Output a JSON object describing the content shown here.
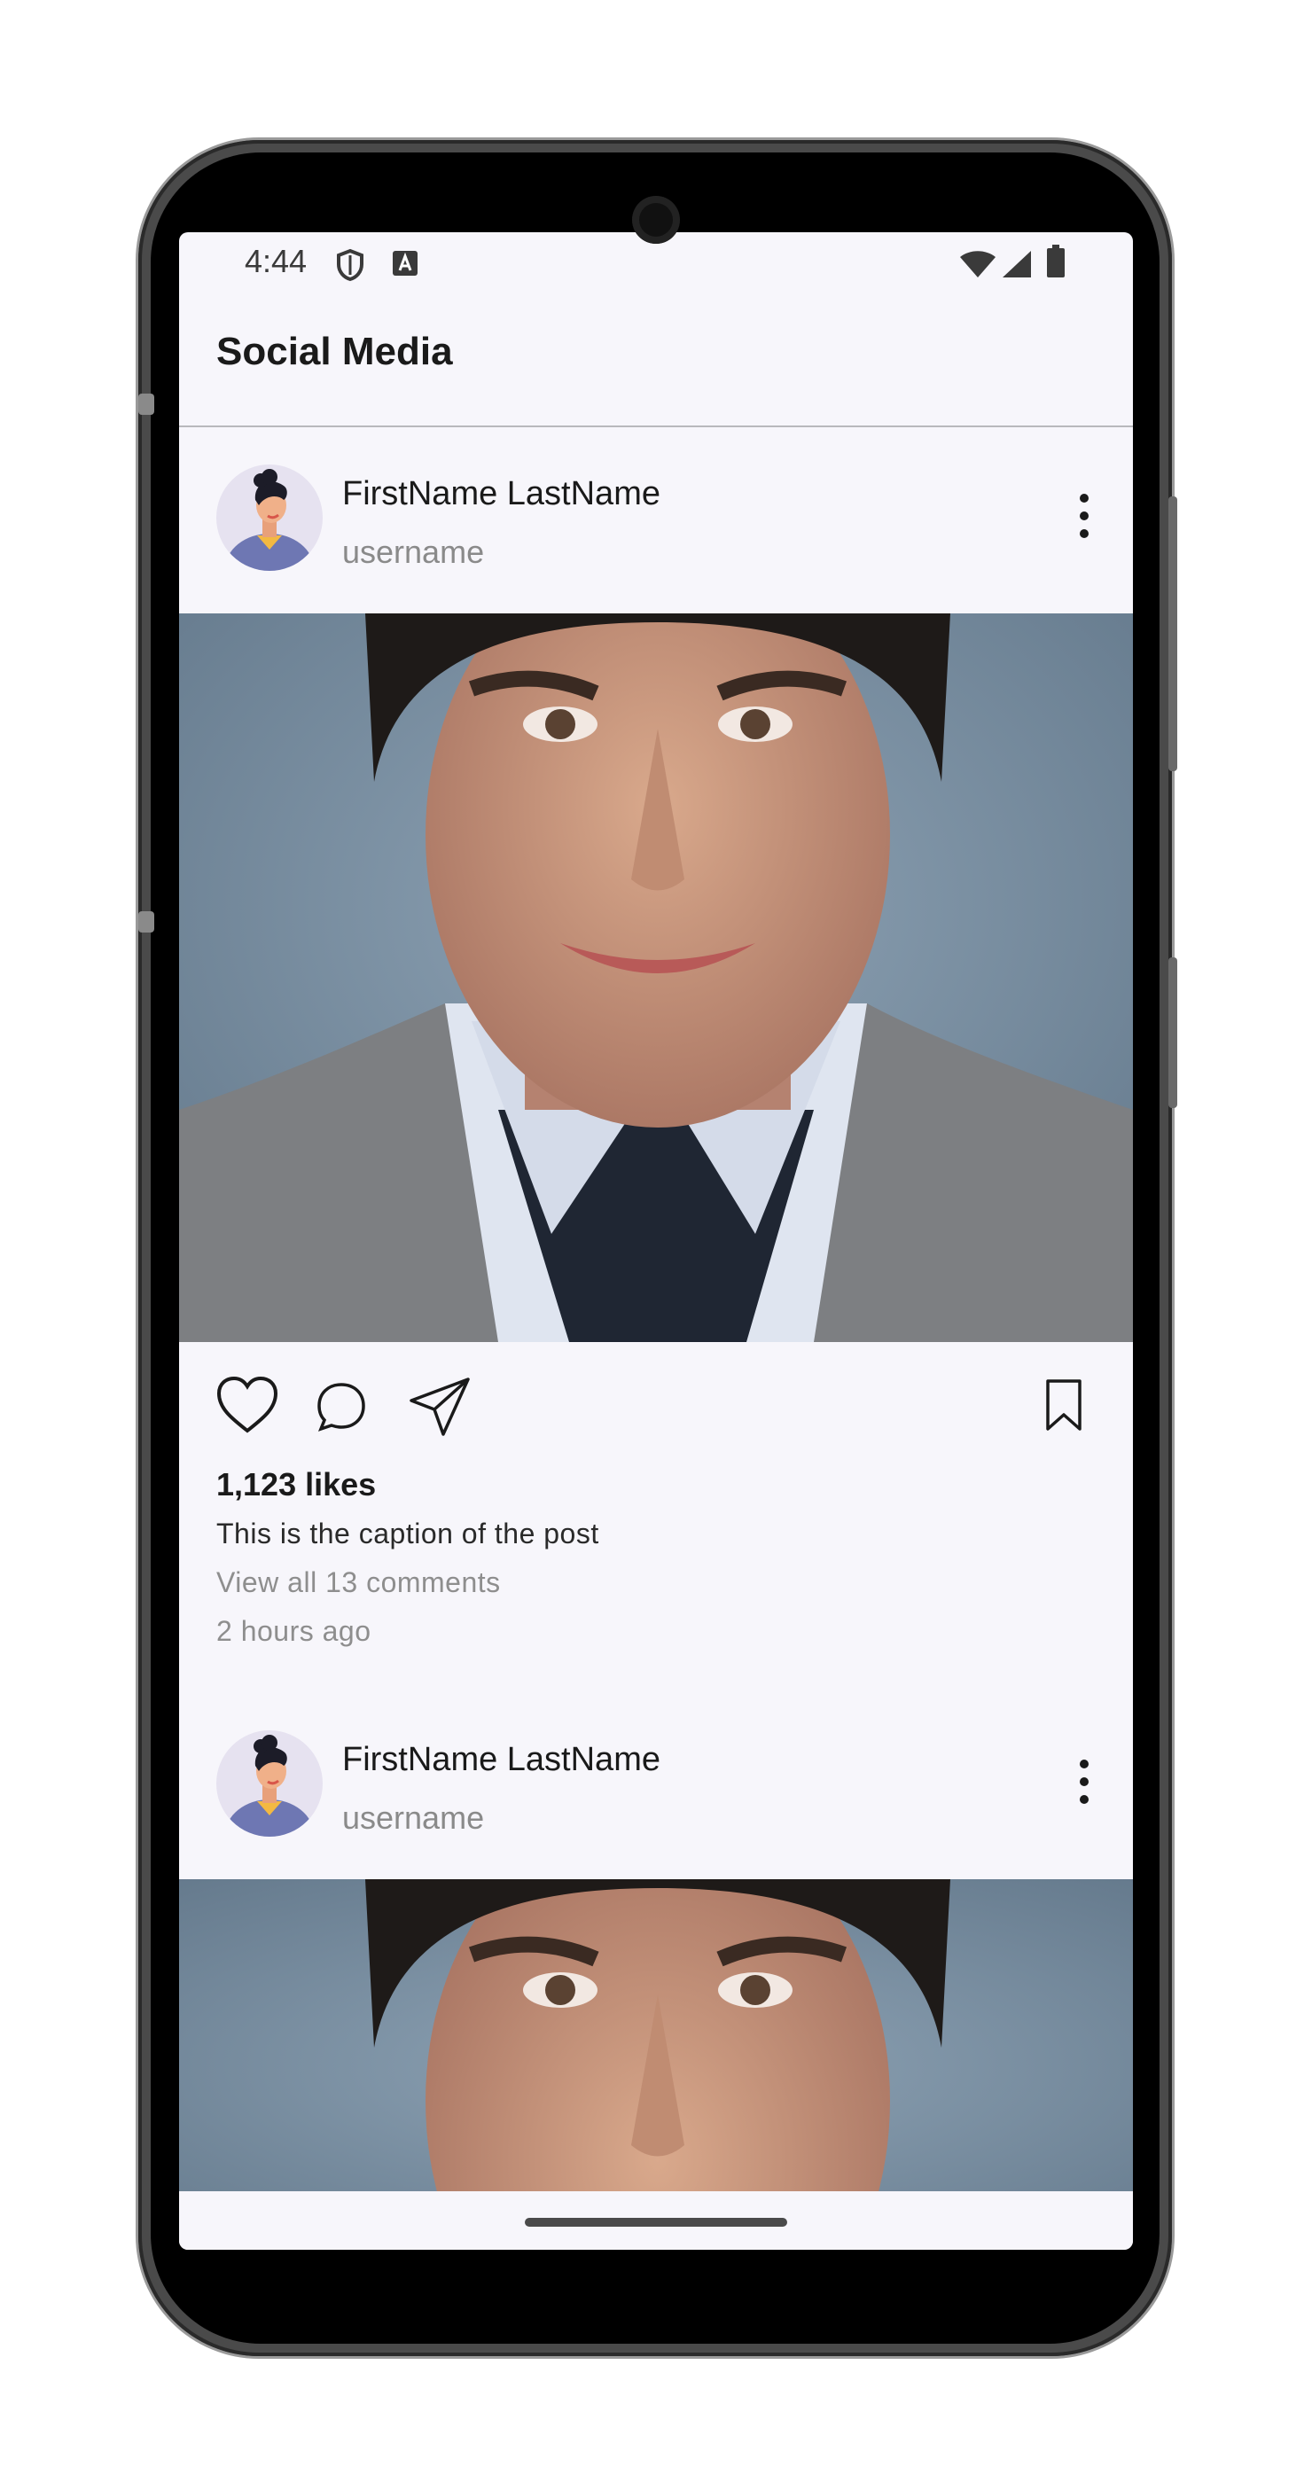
{
  "status_bar": {
    "time": "4:44",
    "icons": [
      "shield-icon",
      "keyboard-a-icon",
      "wifi-icon",
      "cellular-signal-icon",
      "battery-icon"
    ]
  },
  "app_bar": {
    "title": "Social Media"
  },
  "posts": [
    {
      "name": "FirstName LastName",
      "username": "username",
      "likes": "1,123 likes",
      "caption": "This is the caption of the post",
      "comments": "View all 13 comments",
      "time": "2 hours ago"
    },
    {
      "name": "FirstName LastName",
      "username": "username"
    }
  ],
  "colors": {
    "background": "#f7f6fb",
    "avatar_bg": "#e6e2f0",
    "shirt": "#6e77b3",
    "secondary_text": "#8e8e8e"
  }
}
